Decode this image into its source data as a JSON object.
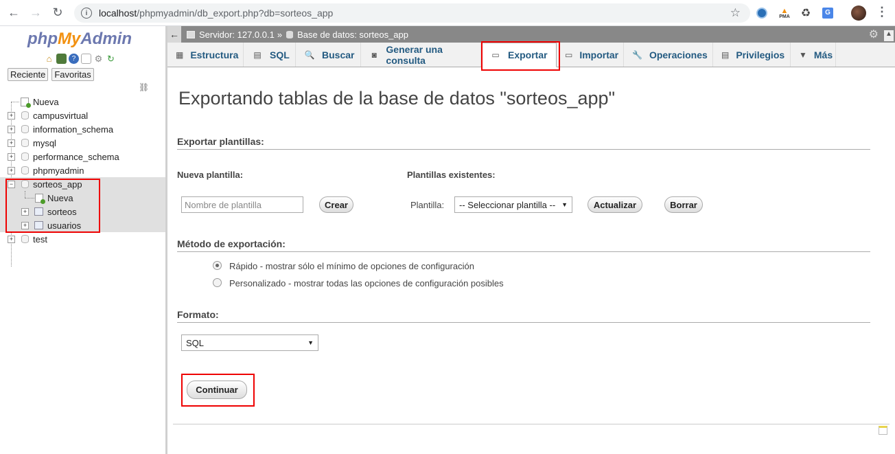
{
  "browser": {
    "url_host": "localhost",
    "url_path": "/phpmyadmin/db_export.php?db=sorteos_app",
    "extensions": [
      "opera-icon",
      "pma-icon",
      "recycle-icon",
      "translate-icon"
    ],
    "ext_labels": [
      "",
      "PMA",
      "",
      ""
    ]
  },
  "sidebar": {
    "logo_php": "php",
    "logo_my": "My",
    "logo_admin": "Admin",
    "tab_recent": "Reciente",
    "tab_favorites": "Favoritas",
    "tree": {
      "new": "Nueva",
      "databases": [
        "campusvirtual",
        "information_schema",
        "mysql",
        "performance_schema",
        "phpmyadmin"
      ],
      "open_db": "sorteos_app",
      "open_db_children": {
        "new": "Nueva",
        "tables": [
          "sorteos",
          "usuarios"
        ]
      },
      "after": [
        "test"
      ]
    }
  },
  "topbar": {
    "server": "Servidor: 127.0.0.1",
    "sep": "»",
    "database": "Base de datos: sorteos_app"
  },
  "menu": {
    "tabs": [
      {
        "label": "Estructura",
        "icon": "structure-icon"
      },
      {
        "label": "SQL",
        "icon": "sql-icon"
      },
      {
        "label": "Buscar",
        "icon": "search-icon"
      },
      {
        "label": "Generar una consulta",
        "icon": "query-icon"
      },
      {
        "label": "Exportar",
        "icon": "export-icon"
      },
      {
        "label": "Importar",
        "icon": "import-icon"
      },
      {
        "label": "Operaciones",
        "icon": "wrench-icon"
      },
      {
        "label": "Privilegios",
        "icon": "privileges-icon"
      },
      {
        "label": "Más",
        "icon": "chevron-down-icon"
      }
    ],
    "active": "Exportar"
  },
  "main": {
    "title": "Exportando tablas de la base de datos \"sorteos_app\"",
    "templates": {
      "heading": "Exportar plantillas:",
      "new_label": "Nueva plantilla:",
      "new_placeholder": "Nombre de plantilla",
      "create_button": "Crear",
      "existing_label": "Plantillas existentes:",
      "template_label": "Plantilla:",
      "template_select": "-- Seleccionar plantilla --",
      "update_button": "Actualizar",
      "delete_button": "Borrar"
    },
    "method": {
      "heading": "Método de exportación:",
      "options": [
        {
          "label": "Rápido - mostrar sólo el mínimo de opciones de configuración",
          "checked": true
        },
        {
          "label": "Personalizado - mostrar todas las opciones de configuración posibles",
          "checked": false
        }
      ]
    },
    "format": {
      "heading": "Formato:",
      "selected": "SQL"
    },
    "continue_button": "Continuar"
  },
  "colors": {
    "highlight": "#e00000",
    "link": "#235a81"
  }
}
